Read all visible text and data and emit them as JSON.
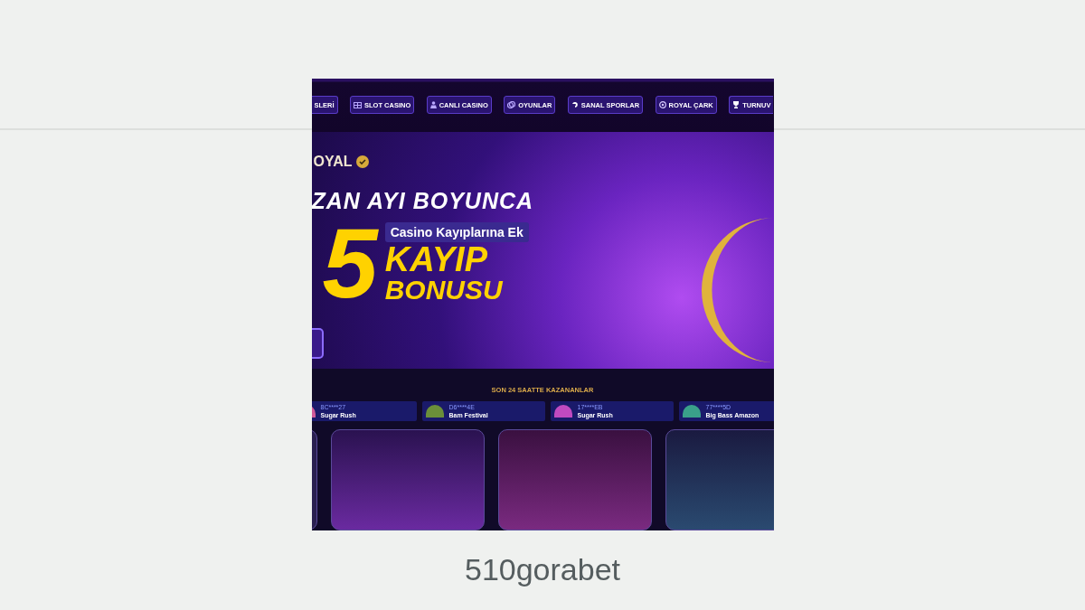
{
  "screenshot": {
    "nav": [
      {
        "label": "SLERİ"
      },
      {
        "label": "SLOT CASINO"
      },
      {
        "label": "CANLI CASINO"
      },
      {
        "label": "OYUNLAR"
      },
      {
        "label": "SANAL SPORLAR"
      },
      {
        "label": "ROYAL ÇARK"
      },
      {
        "label": "TURNUV"
      }
    ],
    "banner": {
      "brand": "OYAL",
      "headline": "ZAN AYI BOYUNCA",
      "tag": "Casino Kayıplarına Ek",
      "number": "5",
      "line_1": "KAYIP",
      "line_2": "BONUSU"
    },
    "winners": {
      "title": "SON 24 SAATTE KAZANANLAR",
      "items": [
        {
          "user": "8C****27",
          "game": "Sugar Rush"
        },
        {
          "user": "D6****4E",
          "game": "Bam Festival"
        },
        {
          "user": "17****EB",
          "game": "Sugar Rush"
        },
        {
          "user": "77****5D",
          "game": "Big Bass Amazon"
        }
      ]
    }
  },
  "caption": "510gorabet"
}
